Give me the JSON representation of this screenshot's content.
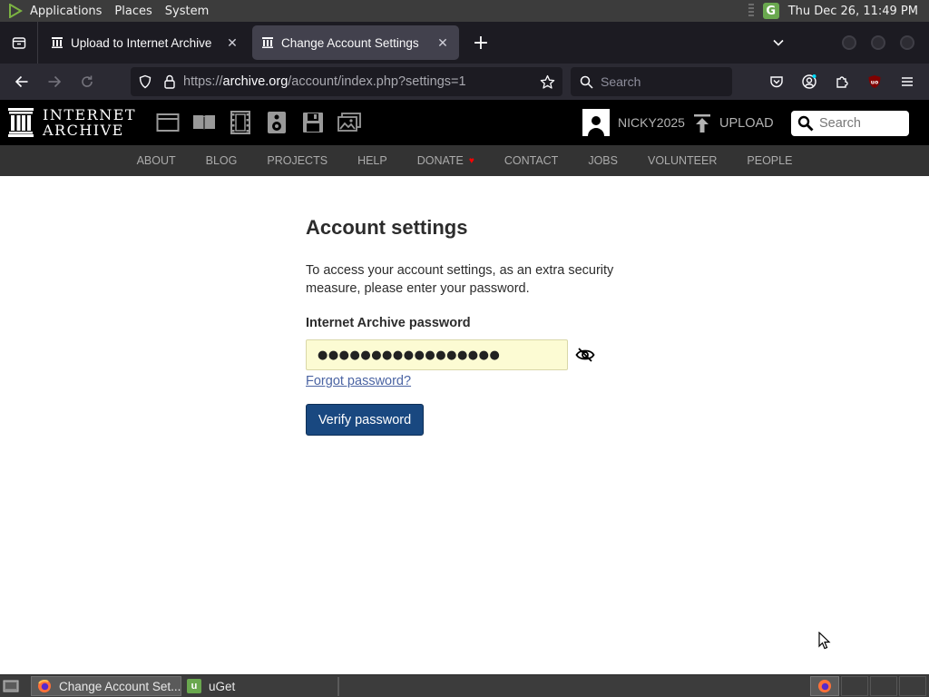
{
  "system_panel": {
    "menus": [
      "Applications",
      "Places",
      "System"
    ],
    "clock": "Thu Dec 26, 11:49 PM"
  },
  "browser": {
    "tabs": [
      {
        "title": "Upload to Internet Archive",
        "active": false
      },
      {
        "title": "Change Account Settings",
        "active": true
      }
    ],
    "url_prefix": "https://",
    "url_host": "archive.org",
    "url_path": "/account/index.php?settings=1",
    "search_placeholder": "Search"
  },
  "ia_header": {
    "logo_line1": "INTERNET",
    "logo_line2": "ARCHIVE",
    "username": "NICKY2025",
    "upload_label": "UPLOAD",
    "search_placeholder": "Search",
    "nav": [
      "ABOUT",
      "BLOG",
      "PROJECTS",
      "HELP",
      "DONATE",
      "CONTACT",
      "JOBS",
      "VOLUNTEER",
      "PEOPLE"
    ]
  },
  "content": {
    "title": "Account settings",
    "description": "To access your account settings, as an extra security measure, please enter your password.",
    "password_label": "Internet Archive password",
    "password_value": "●●●●●●●●●●●●●●●●●",
    "forgot_link": "Forgot password?",
    "verify_button": "Verify password"
  },
  "taskbar": {
    "tasks": [
      {
        "label": "Change Account Set...",
        "active": true
      },
      {
        "label": "uGet",
        "active": false
      }
    ]
  },
  "colors": {
    "ia_black": "#000000",
    "ia_nav_bg": "#333333",
    "verify_button_bg": "#194880",
    "link": "#4b64a3",
    "password_bg": "#fcfbd3"
  }
}
